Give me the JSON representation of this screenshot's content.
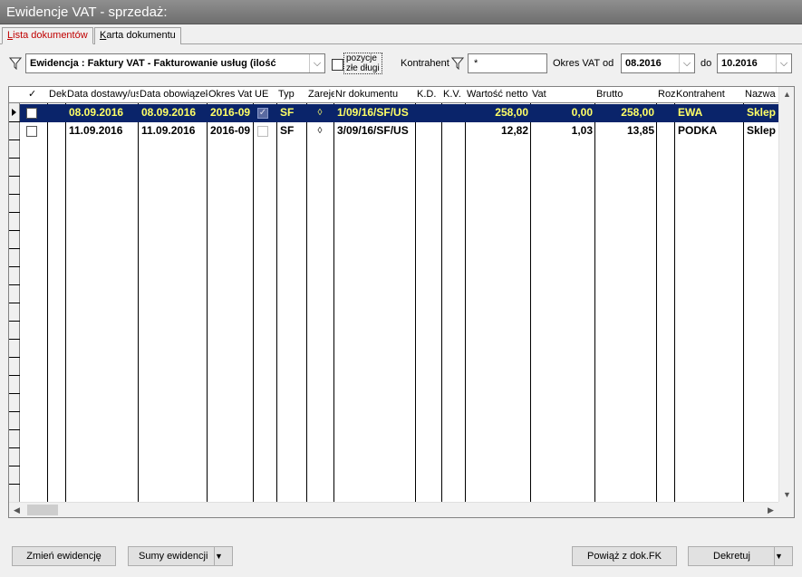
{
  "window": {
    "title": "Ewidencje VAT - sprzedaż:"
  },
  "tabs": [
    {
      "label": "Lista dokumentów",
      "mnemonic": "L",
      "rest": "ista dokumentów",
      "active": true
    },
    {
      "label": "Karta dokumentu",
      "mnemonic": "K",
      "rest": "arta dokumentu",
      "active": false
    }
  ],
  "filters": {
    "ewidencja_value": "Ewidencja : Faktury VAT - Fakturowanie usług   (ilość",
    "pozycje_label_1": "pozycje",
    "pozycje_label_2": "złe długi",
    "kontrahent_label": "Kontrahent",
    "kontrahent_value": "*",
    "okres_od_label": "Okres VAT od",
    "okres_od_value": "08.2016",
    "do_label": "do",
    "okres_do_value": "10.2016"
  },
  "grid": {
    "columns": [
      "✓",
      "Dek",
      "Data dostawy/us",
      "Data obowiązek",
      "Okres Vat",
      "UE",
      "Typ",
      "Zareje",
      "Nr dokumentu",
      "K.D.",
      "K.V.",
      "Wartość netto",
      "Vat",
      "Brutto",
      "Roz",
      "Kontrahent",
      "Nazwa"
    ],
    "rows": [
      {
        "data_dostawy": "08.09.2016",
        "data_obow": "08.09.2016",
        "okres": "2016-09",
        "ue_checked": true,
        "typ": "SF",
        "zarej": "◊",
        "nr": "1/09/16/SF/US",
        "netto": "258,00",
        "vat": "0,00",
        "brutto": "258,00",
        "kontrahent": "EWA",
        "nazwa": "Sklep"
      },
      {
        "data_dostawy": "11.09.2016",
        "data_obow": "11.09.2016",
        "okres": "2016-09",
        "ue_checked": false,
        "typ": "SF",
        "zarej": "◊",
        "nr": "3/09/16/SF/US",
        "netto": "12,82",
        "vat": "1,03",
        "brutto": "13,85",
        "kontrahent": "PODKA",
        "nazwa": "Sklep"
      }
    ]
  },
  "buttons": {
    "zmien": "Zmień ewidencję",
    "sumy": "Sumy ewidencji",
    "powiaz": "Powiąż z dok.FK",
    "dekretuj": "Dekretuj"
  }
}
